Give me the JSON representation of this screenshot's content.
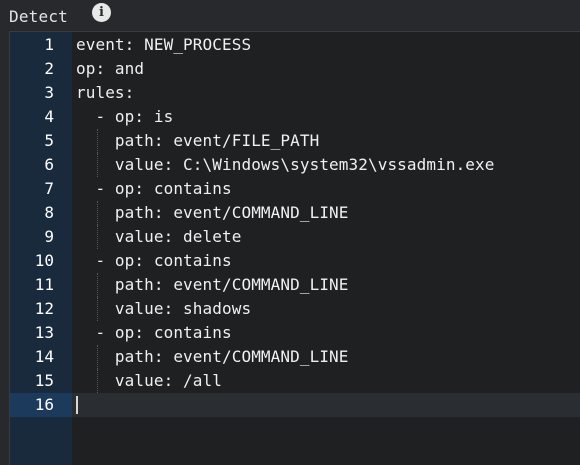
{
  "panel": {
    "title": "Detect",
    "info_icon": "info-icon"
  },
  "editor": {
    "active_line": 16,
    "lines": [
      {
        "num": "1",
        "text": "event: NEW_PROCESS",
        "guides": 0
      },
      {
        "num": "2",
        "text": "op: and",
        "guides": 0
      },
      {
        "num": "3",
        "text": "rules:",
        "guides": 0
      },
      {
        "num": "4",
        "text": "  - op: is",
        "guides": 0
      },
      {
        "num": "5",
        "text": "    path: event/FILE_PATH",
        "guides": 1
      },
      {
        "num": "6",
        "text": "    value: C:\\Windows\\system32\\vssadmin.exe",
        "guides": 1
      },
      {
        "num": "7",
        "text": "  - op: contains",
        "guides": 0
      },
      {
        "num": "8",
        "text": "    path: event/COMMAND_LINE",
        "guides": 1
      },
      {
        "num": "9",
        "text": "    value: delete",
        "guides": 1
      },
      {
        "num": "10",
        "text": "  - op: contains",
        "guides": 0
      },
      {
        "num": "11",
        "text": "    path: event/COMMAND_LINE",
        "guides": 1
      },
      {
        "num": "12",
        "text": "    value: shadows",
        "guides": 1
      },
      {
        "num": "13",
        "text": "  - op: contains",
        "guides": 0
      },
      {
        "num": "14",
        "text": "    path: event/COMMAND_LINE",
        "guides": 1
      },
      {
        "num": "15",
        "text": "    value: /all",
        "guides": 1
      },
      {
        "num": "16",
        "text": "",
        "guides": 0
      }
    ]
  }
}
